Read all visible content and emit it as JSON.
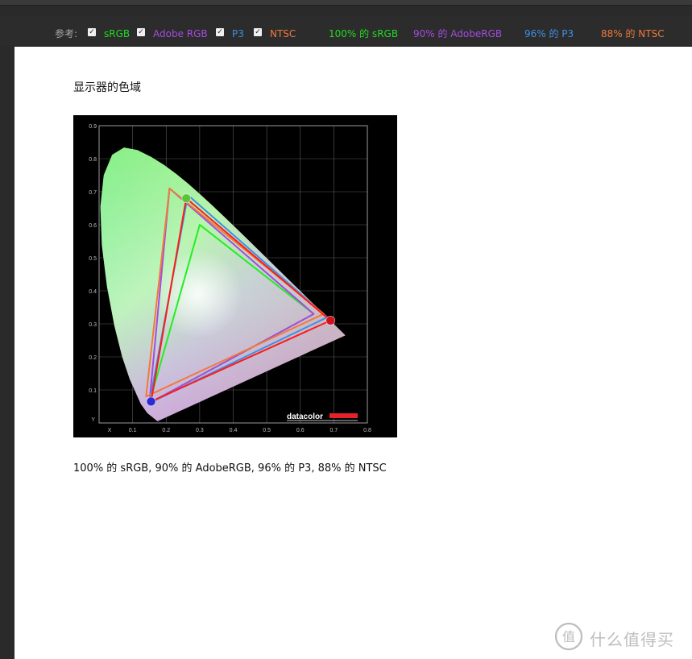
{
  "toolbar": {
    "reference_label": "参考:",
    "checkboxes": [
      {
        "label": "sRGB",
        "checked": true,
        "color": "#22d922"
      },
      {
        "label": "Adobe RGB",
        "checked": true,
        "color": "#a64be0"
      },
      {
        "label": "P3",
        "checked": true,
        "color": "#3f8fe6"
      },
      {
        "label": "NTSC",
        "checked": true,
        "color": "#f07a3a"
      }
    ],
    "results": [
      {
        "text": "100% 的 sRGB",
        "color": "#22d922"
      },
      {
        "text": "90% 的 AdobeRGB",
        "color": "#a64be0"
      },
      {
        "text": "96% 的 P3",
        "color": "#3f8fe6"
      },
      {
        "text": "88% 的 NTSC",
        "color": "#f07a3a"
      }
    ]
  },
  "content": {
    "heading": "显示器的色域",
    "caption": "100% 的 sRGB, 90% 的 AdobeRGB, 96% 的 P3, 88% 的 NTSC"
  },
  "chart_data": {
    "type": "scatter",
    "title": "",
    "xlabel": "X",
    "ylabel": "Y",
    "x_ticks": [
      "0.1",
      "0.2",
      "0.3",
      "0.4",
      "0.5",
      "0.6",
      "0.7",
      "0.8"
    ],
    "y_ticks": [
      "0.1",
      "0.2",
      "0.3",
      "0.4",
      "0.5",
      "0.6",
      "0.7",
      "0.8",
      "0.9"
    ],
    "xlim": [
      0,
      0.8
    ],
    "ylim": [
      0,
      0.9
    ],
    "grid": true,
    "brand": "datacolor",
    "series": [
      {
        "name": "sRGB",
        "color": "#22ee22",
        "points": [
          [
            0.64,
            0.33
          ],
          [
            0.3,
            0.6
          ],
          [
            0.15,
            0.06
          ]
        ]
      },
      {
        "name": "Adobe RGB",
        "color": "#a64be0",
        "points": [
          [
            0.64,
            0.33
          ],
          [
            0.21,
            0.71
          ],
          [
            0.15,
            0.06
          ]
        ]
      },
      {
        "name": "P3",
        "color": "#3f8fe6",
        "points": [
          [
            0.68,
            0.32
          ],
          [
            0.265,
            0.69
          ],
          [
            0.15,
            0.06
          ]
        ]
      },
      {
        "name": "NTSC",
        "color": "#f07a3a",
        "points": [
          [
            0.67,
            0.33
          ],
          [
            0.21,
            0.71
          ],
          [
            0.14,
            0.08
          ]
        ]
      },
      {
        "color": "#ff1a1a",
        "points": [
          [
            0.69,
            0.31
          ],
          [
            0.26,
            0.68
          ],
          [
            0.155,
            0.065
          ]
        ]
      }
    ],
    "primaries": [
      {
        "x": 0.69,
        "y": 0.31,
        "color": "#d0101a"
      },
      {
        "x": 0.26,
        "y": 0.68,
        "color": "#5bc23a"
      },
      {
        "x": 0.155,
        "y": 0.065,
        "color": "#2b2bd6"
      }
    ]
  },
  "watermark": {
    "text": "什么值得买"
  }
}
